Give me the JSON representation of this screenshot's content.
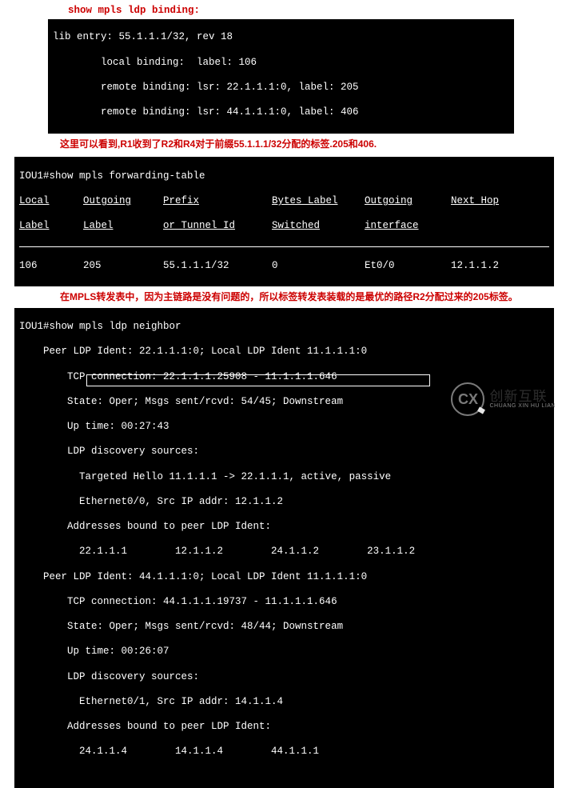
{
  "section1": {
    "title": "show mpls ldp binding:",
    "lines": {
      "l1": "lib entry: 55.1.1.1/32, rev 18",
      "l2": "        local binding:  label: 106",
      "l3": "        remote binding: lsr: 22.1.1.1:0, label: 205",
      "l4": "        remote binding: lsr: 44.1.1.1:0, label: 406"
    }
  },
  "anno1": "这里可以看到,R1收到了R2和R4对于前缀55.1.1.1/32分配的标签.205和406.",
  "fwd": {
    "prompt": "IOU1#show mpls forwarding-table",
    "hdr": {
      "c1a": "Local",
      "c1b": "Label",
      "c2a": "Outgoing",
      "c2b": "Label",
      "c3a": "Prefix",
      "c3b": "or Tunnel Id",
      "c4a": "Bytes Label",
      "c4b": "Switched",
      "c5a": "Outgoing",
      "c5b": "interface",
      "c6a": "Next Hop",
      "c6b": ""
    },
    "row": {
      "c1": "106",
      "c2": "205",
      "c3": "55.1.1.1/32",
      "c4": "0",
      "c5": "Et0/0",
      "c6": "12.1.1.2"
    }
  },
  "anno2": "在MPLS转发表中，因为主链路是没有问题的，所以标签转发表装载的是最优的路径R2分配过来的205标签。",
  "neighbor": {
    "prompt": "IOU1#show mpls ldp neighbor",
    "l01": "    Peer LDP Ident: 22.1.1.1:0; Local LDP Ident 11.1.1.1:0",
    "l02": "        TCP connection: 22.1.1.1.25908 - 11.1.1.1.646",
    "l03": "        State: Oper; Msgs sent/rcvd: 54/45; Downstream",
    "l04": "        Up time: 00:27:43",
    "l05": "        LDP discovery sources:",
    "l06": "          Targeted Hello 11.1.1.1 -> 22.1.1.1, active, passive",
    "l07": "          Ethernet0/0, Src IP addr: 12.1.1.2",
    "l08": "        Addresses bound to peer LDP Ident:",
    "l09": "          22.1.1.1        12.1.1.2        24.1.1.2        23.1.1.2",
    "l10": "    Peer LDP Ident: 44.1.1.1:0; Local LDP Ident 11.1.1.1:0",
    "l11": "        TCP connection: 44.1.1.1.19737 - 11.1.1.1.646",
    "l12": "        State: Oper; Msgs sent/rcvd: 48/44; Downstream",
    "l13": "        Up time: 00:26:07",
    "l14": "        LDP discovery sources:",
    "l15": "          Ethernet0/1, Src IP addr: 14.1.1.4",
    "l16": "        Addresses bound to peer LDP Ident:",
    "l17": "          24.1.1.4        14.1.1.4        44.1.1.1"
  },
  "watermark": {
    "logo": "CX",
    "cn": "创新互联",
    "en": "CHUANG XIN HU LIAN"
  }
}
